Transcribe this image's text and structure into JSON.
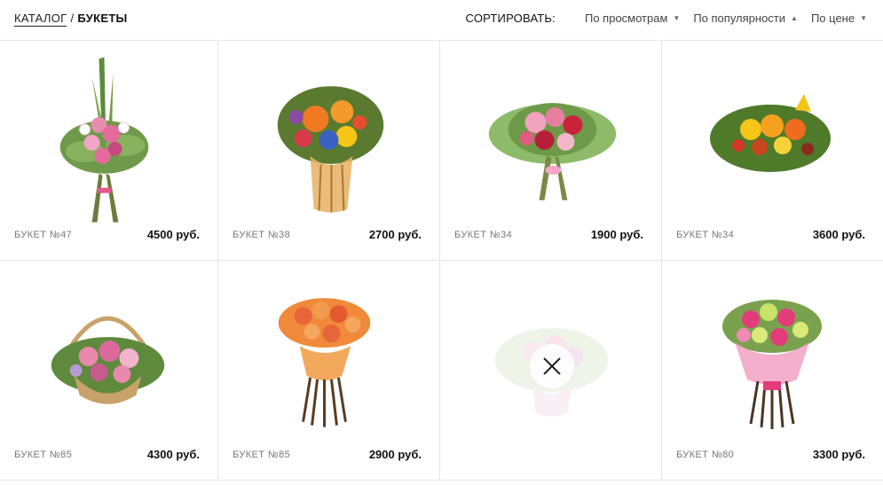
{
  "breadcrumb": {
    "catalog": "КАТАЛОГ",
    "separator": "/",
    "current": "БУКЕТЫ"
  },
  "sort": {
    "label": "СОРТИРОВАТЬ:",
    "options": [
      {
        "label": "По просмотрам",
        "arrow": "▼"
      },
      {
        "label": "По популярности",
        "arrow": "▲"
      },
      {
        "label": "По цене",
        "arrow": "▼"
      }
    ]
  },
  "products": [
    {
      "name": "БУКЕТ №47",
      "price": "4500 руб.",
      "image": "tall-pink-lily-bouquet"
    },
    {
      "name": "БУКЕТ №38",
      "price": "2700 руб.",
      "image": "orange-gerbera-bouquet"
    },
    {
      "name": "БУКЕТ №34",
      "price": "1900 руб.",
      "image": "pink-red-rose-bouquet"
    },
    {
      "name": "БУКЕТ №34",
      "price": "3600 руб.",
      "image": "yellow-orange-lily-bouquet"
    },
    {
      "name": "БУКЕТ №85",
      "price": "4300 руб.",
      "image": "flower-basket"
    },
    {
      "name": "БУКЕТ №85",
      "price": "2900 руб.",
      "image": "orange-rose-bouquet"
    },
    {
      "name": "",
      "price": "",
      "image": "faded-pink-bouquet",
      "close_icon": "close-icon"
    },
    {
      "name": "БУКЕТ №80",
      "price": "3300 руб.",
      "image": "pink-green-rose-bouquet"
    }
  ]
}
